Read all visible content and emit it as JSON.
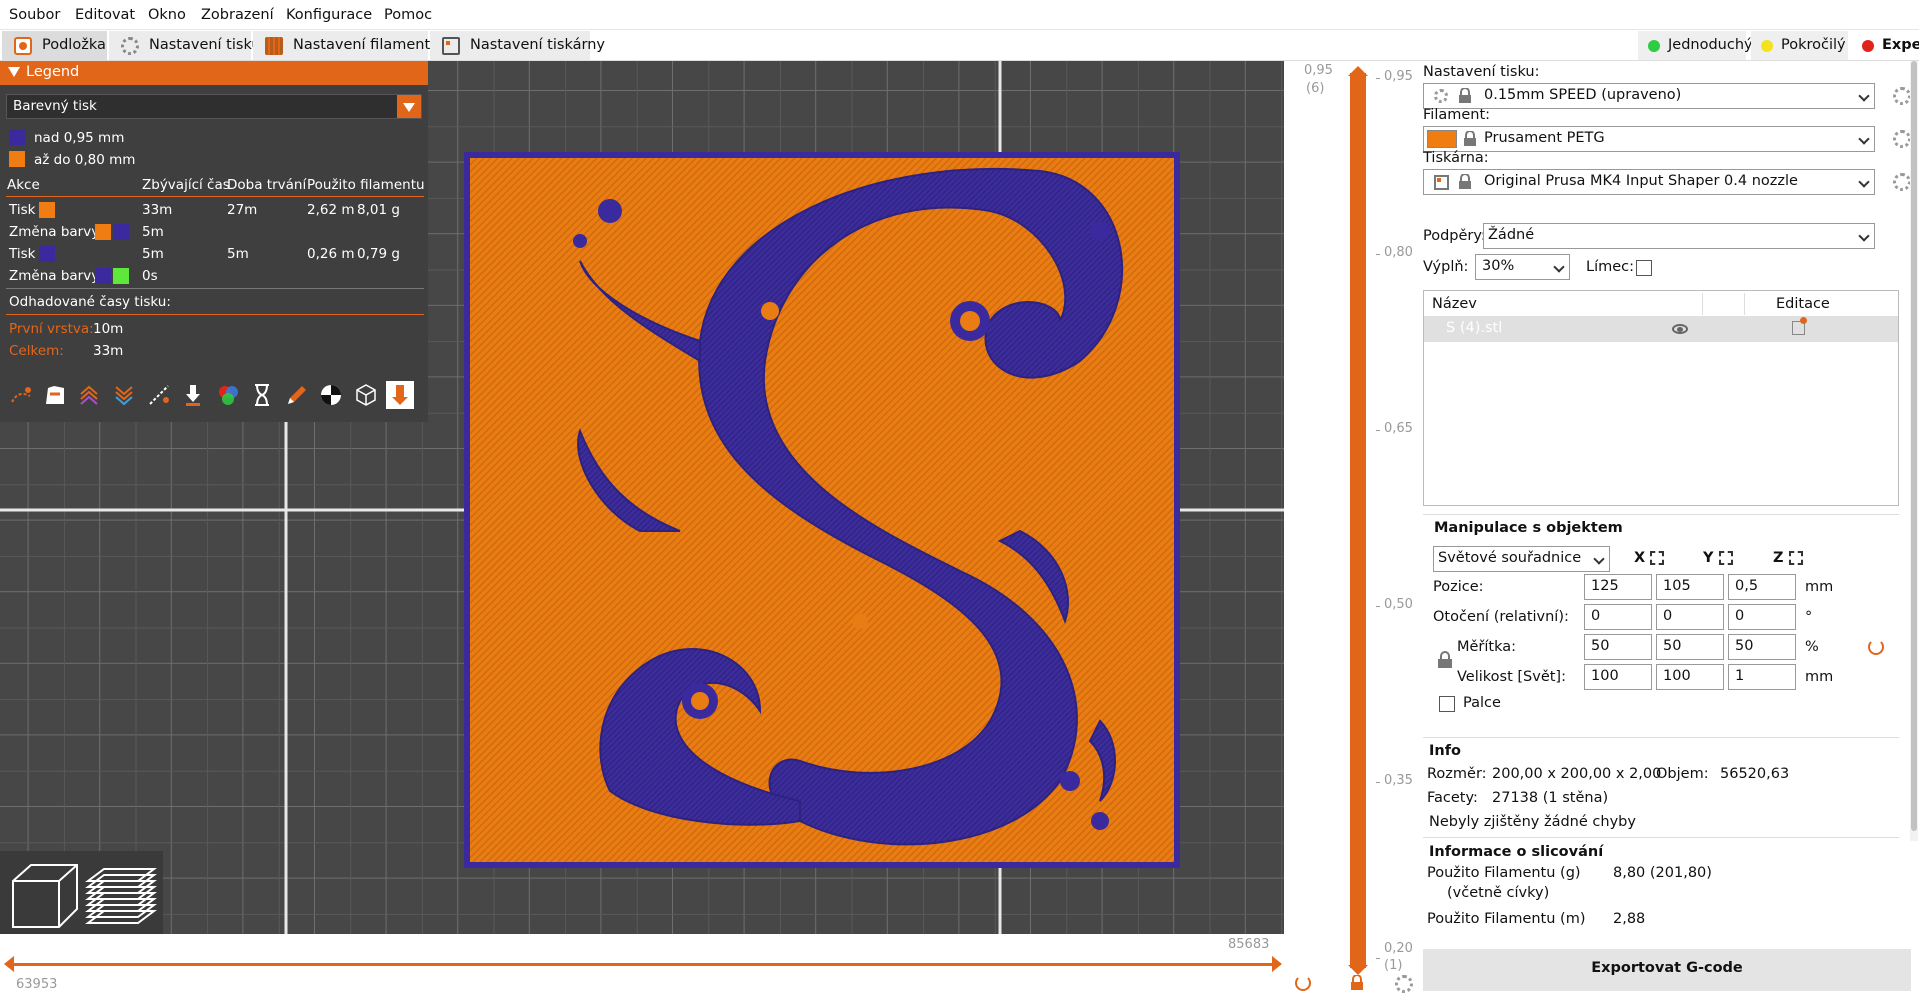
{
  "menu": [
    "Soubor",
    "Editovat",
    "Okno",
    "Zobrazení",
    "Konfigurace",
    "Pomoc"
  ],
  "tabs": [
    {
      "label": "Podložka",
      "icon": "bed-icon"
    },
    {
      "label": "Nastavení tisku",
      "icon": "print-settings-icon"
    },
    {
      "label": "Nastavení filamentu",
      "icon": "filament-icon"
    },
    {
      "label": "Nastavení tiskárny",
      "icon": "printer-icon"
    }
  ],
  "modes": [
    {
      "label": "Jednoduchý",
      "color": "#2ecc40"
    },
    {
      "label": "Pokročilý",
      "color": "#f4e21b"
    },
    {
      "label": "Expert",
      "color": "#e0241c"
    }
  ],
  "legend": {
    "title": "Legend",
    "view_type": "Barevný tisk",
    "ranges": [
      {
        "label": "nad 0,95 mm",
        "color": "#3a2a9e"
      },
      {
        "label": "až do 0,80 mm",
        "color": "#f07d12"
      }
    ],
    "columns": [
      "Akce",
      "Zbývající čas",
      "Doba trvání",
      "Použito filamentu"
    ],
    "rows": [
      {
        "action": "Tisk",
        "colors": [
          "#f07d12"
        ],
        "remaining": "33m",
        "duration": "27m",
        "length": "2,62 m",
        "weight": "8,01 g"
      },
      {
        "action": "Změna barvy",
        "colors": [
          "#f07d12",
          "#3a2a9e"
        ],
        "remaining": "5m",
        "duration": "",
        "length": "",
        "weight": ""
      },
      {
        "action": "Tisk",
        "colors": [
          "#3a2a9e"
        ],
        "remaining": "5m",
        "duration": "5m",
        "length": "0,26 m",
        "weight": "0,79 g"
      },
      {
        "action": "Změna barvy",
        "colors": [
          "#3a2a9e",
          "#5ee83a"
        ],
        "remaining": "0s",
        "duration": "",
        "length": "",
        "weight": ""
      }
    ],
    "estimated_title": "Odhadované časy tisku:",
    "first_layer_label": "První vrstva:",
    "first_layer_value": "10m",
    "total_label": "Celkem:",
    "total_value": "33m",
    "toolbar_icons": [
      "travel-icon",
      "wipe-icon",
      "retractions-icon",
      "deretractions-icon",
      "seams-icon",
      "tool-change-icon",
      "color-change-icon",
      "pause-icon",
      "custom-gcode-icon",
      "center-of-gravity-icon",
      "shells-icon",
      "tool-marker-icon"
    ]
  },
  "layer_slider": {
    "top_value": "0,95",
    "top_layer": "(6)",
    "bottom_value": "0,20",
    "bottom_layer": "(1)",
    "ticks": [
      "0,95",
      "0,80",
      "0,65",
      "0,50",
      "0,35",
      "0,20"
    ]
  },
  "horizontal_slider": {
    "left_value": "63953",
    "right_value": "85683"
  },
  "right": {
    "print_settings_label": "Nastavení tisku:",
    "print_profile": "0.15mm SPEED (upraveno)",
    "filament_label": "Filament:",
    "filament_profile": "Prusament PETG",
    "filament_color": "#f07d12",
    "printer_label": "Tiskárna:",
    "printer_profile": "Original Prusa MK4 Input Shaper 0.4 nozzle",
    "supports_label": "Podpěry:",
    "supports_value": "Žádné",
    "infill_label": "Výplň:",
    "infill_value": "30%",
    "brim_label": "Límec:",
    "object_list": {
      "col_name": "Název",
      "col_edit": "Editace",
      "items": [
        "S (4).stl"
      ]
    },
    "manipulation": {
      "title": "Manipulace s objektem",
      "coord_system": "Světové souřadnice",
      "axes": [
        "X",
        "Y",
        "Z"
      ],
      "position_label": "Pozice:",
      "position": [
        "125",
        "105",
        "0,5"
      ],
      "position_unit": "mm",
      "rotation_label": "Otočení (relativní):",
      "rotation": [
        "0",
        "0",
        "0"
      ],
      "rotation_unit": "°",
      "scale_label": "Měřítka:",
      "scale": [
        "50",
        "50",
        "50"
      ],
      "scale_unit": "%",
      "size_label": "Velikost [Svět]:",
      "size": [
        "100",
        "100",
        "1"
      ],
      "size_unit": "mm",
      "inches_label": "Palce"
    },
    "info": {
      "title": "Info",
      "size_label": "Rozměr:",
      "size_value": "200,00 x 200,00 x 2,00",
      "volume_label": "Objem:",
      "volume_value": "56520,63",
      "facets_label": "Facety:",
      "facets_value": "27138 (1 stěna)",
      "errors": "Nebyly zjištěny žádné chyby"
    },
    "slice_info": {
      "title": "Informace o slicování",
      "used_g_label": "Použito Filamentu (g)",
      "used_g_value": "8,80 (201,80)",
      "spool_note": "(včetně cívky)",
      "used_m_label": "Použito Filamentu (m)",
      "used_m_value": "2,88"
    },
    "export_button": "Exportovat G-code"
  }
}
